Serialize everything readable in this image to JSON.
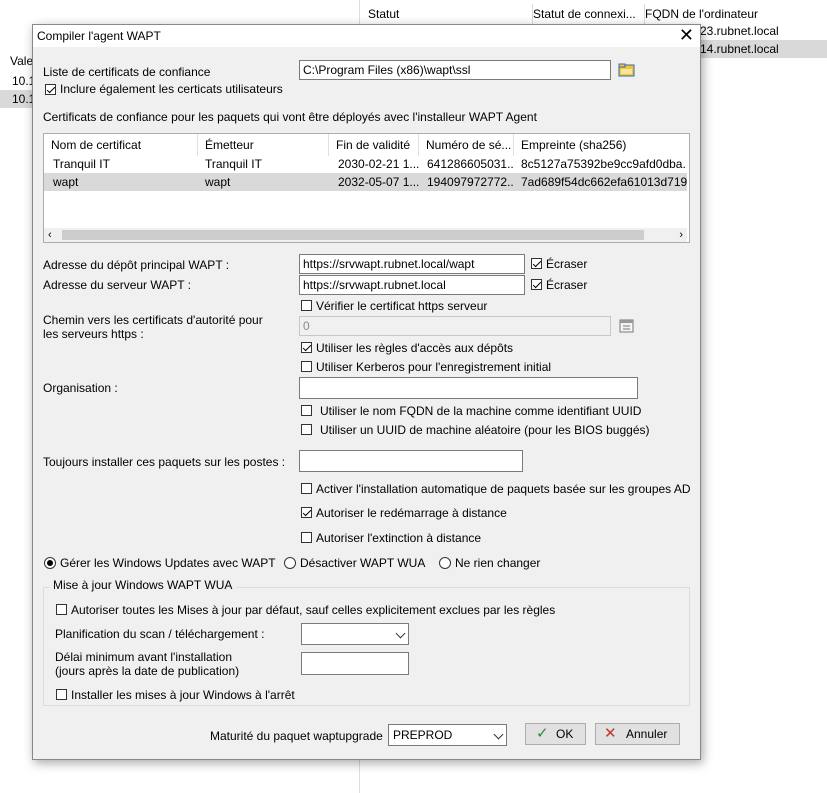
{
  "background": {
    "columns": [
      "Statut",
      "Statut de connexi...",
      "FQDN de l'ordinateur"
    ],
    "rows": [
      "23.rubnet.local",
      "14.rubnet.local"
    ],
    "left_header": "Vale",
    "left_rows": [
      "10.1",
      "10.1"
    ]
  },
  "dialog": {
    "title": "Compiler l'agent WAPT",
    "cert_list_label": "Liste de certificats de confiance",
    "cert_list_path": "C:\\Program Files (x86)\\wapt\\ssl",
    "include_user_certs_label": "Inclure également les certicats utilisateurs",
    "include_user_certs_checked": true,
    "trusted_certs_caption": "Certificats de confiance pour les paquets qui vont être déployés avec l'installeur WAPT Agent",
    "table": {
      "columns": [
        "Nom de certificat",
        "Émetteur",
        "Fin de validité",
        "Numéro de sé...",
        "Empreinte (sha256)"
      ],
      "rows": [
        {
          "name": "Tranquil IT",
          "issuer": "Tranquil IT",
          "validity": "2030-02-21 1...",
          "serial": "641286605031...",
          "fingerprint": "8c5127a75392be9cc9afd0dba..."
        },
        {
          "name": "wapt",
          "issuer": "wapt",
          "validity": "2032-05-07 1...",
          "serial": "194097972772...",
          "fingerprint": "7ad689f54dc662efa61013d719..."
        }
      ]
    },
    "repo_label": "Adresse du dépôt principal WAPT :",
    "repo_value": "https://srvwapt.rubnet.local/wapt",
    "repo_overwrite_label": "Écraser",
    "repo_overwrite_checked": true,
    "server_label": "Adresse du serveur WAPT :",
    "server_value": "https://srvwapt.rubnet.local",
    "server_overwrite_label": "Écraser",
    "server_overwrite_checked": true,
    "verify_https_label": "Vérifier le certificat https serveur",
    "verify_https_checked": false,
    "ca_path_label_line1": "Chemin vers les certificats d'autorité pour",
    "ca_path_label_line2": "les serveurs https :",
    "ca_path_value": "0",
    "use_repo_rules_label": "Utiliser les règles d'accès aux dépôts",
    "use_repo_rules_checked": true,
    "use_kerberos_label": "Utiliser Kerberos pour l'enregistrement initial",
    "use_kerberos_checked": false,
    "organisation_label": "Organisation :",
    "organisation_value": "",
    "fqdn_uuid_label": "Utiliser le nom FQDN de la machine comme identifiant UUID",
    "fqdn_uuid_checked": false,
    "random_uuid_label": "Utiliser un UUID de machine aléatoire (pour les BIOS buggés)",
    "random_uuid_checked": false,
    "always_install_label": "Toujours installer ces paquets sur les postes :",
    "always_install_value": "",
    "ad_groups_label": "Activer l'installation automatique de paquets basée sur les groupes AD",
    "ad_groups_checked": false,
    "remote_reboot_label": "Autoriser le redémarrage à distance",
    "remote_reboot_checked": true,
    "remote_shutdown_label": "Autoriser l'extinction à distance",
    "remote_shutdown_checked": false,
    "wu_options": [
      "Gérer les Windows Updates avec WAPT",
      "Désactiver WAPT WUA",
      "Ne rien changer"
    ],
    "wu_selected": 0,
    "wua_group_title": "Mise à jour Windows WAPT WUA",
    "allow_all_updates_label": "Autoriser toutes les Mises à jour par défaut, sauf celles explicitement exclues par les règles",
    "allow_all_updates_checked": false,
    "scan_schedule_label": "Planification du scan / téléchargement :",
    "scan_schedule_value": "",
    "min_delay_label_line1": "Délai minimum avant l'installation",
    "min_delay_label_line2": "(jours après la date de publication)",
    "min_delay_value": "",
    "install_on_shutdown_label": "Installer les mises à jour Windows à l'arrêt",
    "install_on_shutdown_checked": false,
    "maturity_label": "Maturité du paquet waptupgrade",
    "maturity_value": "PREPROD",
    "ok_label": "OK",
    "cancel_label": "Annuler"
  }
}
